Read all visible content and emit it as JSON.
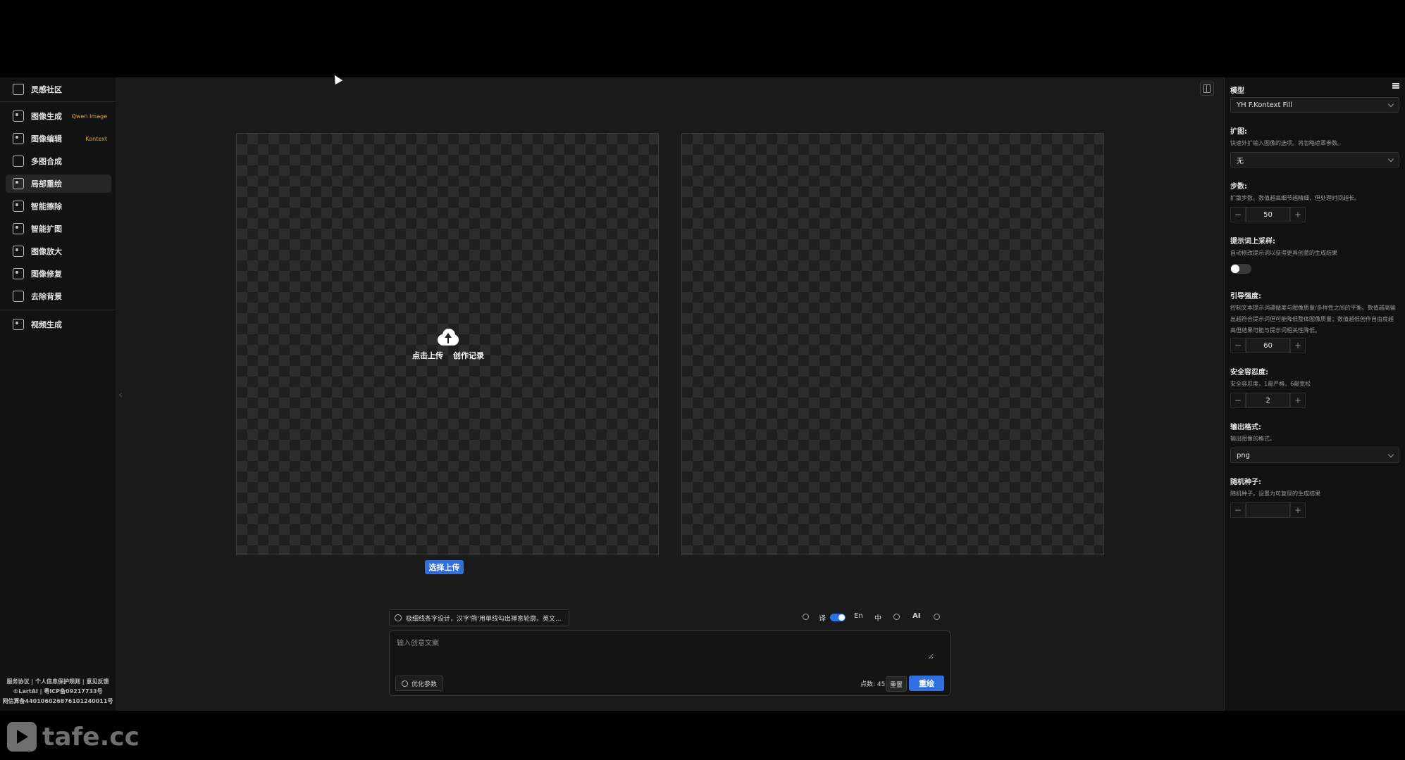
{
  "sidebar": {
    "items": [
      {
        "label": "灵感社区",
        "icon": "house-icon"
      },
      {
        "label": "图像生成",
        "icon": "image-gen-icon",
        "tag": "Qwen Image"
      },
      {
        "label": "图像编辑",
        "icon": "image-edit-icon",
        "tag": "Kontext"
      },
      {
        "label": "多图合成",
        "icon": "layers-icon"
      },
      {
        "label": "局部重绘",
        "icon": "inpaint-icon",
        "active": true
      },
      {
        "label": "智能擦除",
        "icon": "eraser-icon"
      },
      {
        "label": "智能扩图",
        "icon": "expand-icon"
      },
      {
        "label": "图像放大",
        "icon": "zoom-icon"
      },
      {
        "label": "图像修复",
        "icon": "repair-icon"
      },
      {
        "label": "去除背景",
        "icon": "remove-bg-icon"
      },
      {
        "label": "视频生成",
        "icon": "video-icon"
      }
    ],
    "footer": {
      "line1": "服务协议 | 个人信息保护规则 | 意见反馈",
      "line2": "©LartAI | 粤ICP备09217733号",
      "line3": "网信算备440106026876101240011号"
    }
  },
  "canvas": {
    "upload_label": "点击上传",
    "history_label": "创作记录",
    "select_upload_button": "选择上传"
  },
  "prompt": {
    "chip_text": "极细线条字设计，汉字'熊'用单线勾出禅意轮廓，英文...",
    "translate_label": "译",
    "lang_en": "En",
    "lang_zh": "中",
    "ai_label": "AI",
    "placeholder": "输入创意文案",
    "optimize_button": "优化参数",
    "points": "点数: 45",
    "reset_button": "重置",
    "submit_button": "重绘"
  },
  "panel": {
    "model_label": "模型",
    "model_value": "YH F.Kontext Fill",
    "expand_label": "扩图:",
    "expand_desc": "快速外扩输入图像的选项。将忽略遮罩参数。",
    "expand_value": "无",
    "steps_label": "步数:",
    "steps_desc": "扩散步数。数值越高细节越精细，但处理时间越长。",
    "steps_value": "50",
    "upsample_label": "提示词上采样:",
    "upsample_desc": "自动修改提示词以获得更具创意的生成结果",
    "upsample_on": false,
    "guidance_label": "引导强度:",
    "guidance_desc": "控制文本提示词遵循度与图像质量/多样性之间的平衡。数值越高输出越符合提示词但可能降低整体图像质量；数值越低创作自由度越高但结果可能与提示词相关性降低。",
    "guidance_value": "60",
    "safety_label": "安全容忍度:",
    "safety_desc": "安全容忍度，1最严格，6最宽松",
    "safety_value": "2",
    "format_label": "输出格式:",
    "format_desc": "输出图像的格式。",
    "format_value": "png",
    "seed_label": "随机种子:",
    "seed_desc": "随机种子。设置为可复现的生成结果",
    "seed_value": ""
  },
  "watermark": "tafe.cc",
  "colors": {
    "accent": "#2f6fe0",
    "tag": "#d6a84f",
    "background": "#1a1a1a"
  }
}
